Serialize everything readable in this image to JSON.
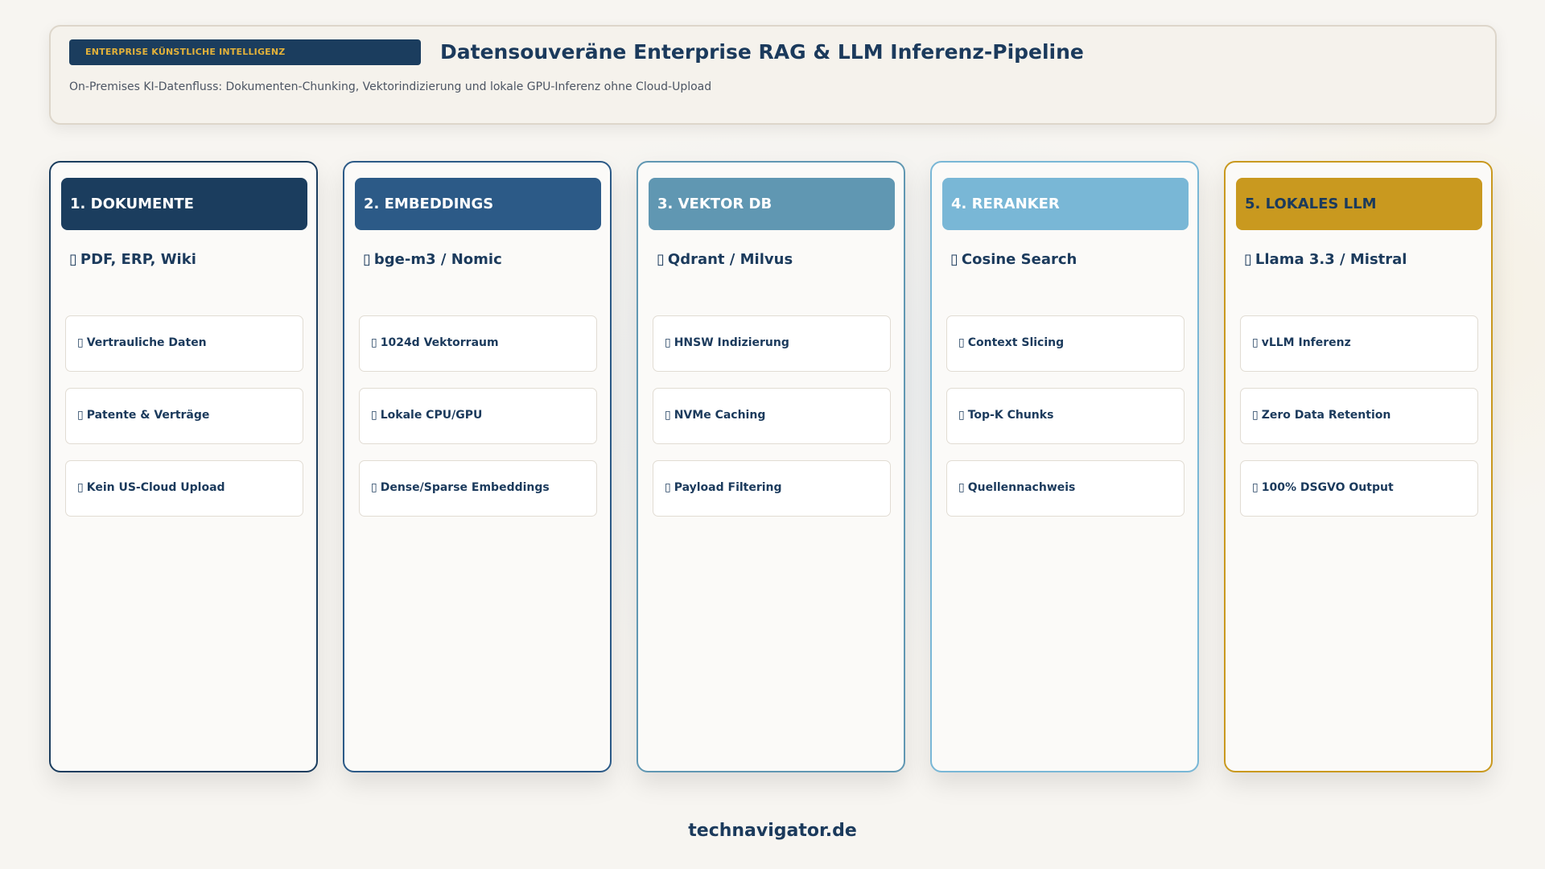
{
  "header": {
    "badge": "ENTERPRISE KÜNSTLICHE INTELLIGENZ",
    "title": "Datensouveräne Enterprise RAG & LLM Inferenz-Pipeline",
    "subtitle": "On-Premises KI-Datenfluss: Dokumenten-Chunking, Vektorindizierung und lokale GPU-Inferenz ohne Cloud-Upload"
  },
  "glyph": "▯",
  "columns": [
    {
      "title": "1. DOKUMENTE",
      "subtitle": "PDF, ERP, Wiki",
      "head_color": "#1b3d5e",
      "head_text": "#ffffff",
      "border_color": "#1b3d5e",
      "items": [
        "Vertrauliche Daten",
        "Patente & Verträge",
        "Kein US-Cloud Upload"
      ]
    },
    {
      "title": "2. EMBEDDINGS",
      "subtitle": "bge-m3 / Nomic",
      "head_color": "#2c5a87",
      "head_text": "#ffffff",
      "border_color": "#2c5a87",
      "items": [
        "1024d Vektorraum",
        "Lokale CPU/GPU",
        "Dense/Sparse Embeddings"
      ]
    },
    {
      "title": "3. VEKTOR DB",
      "subtitle": "Qdrant / Milvus",
      "head_color": "#6097b2",
      "head_text": "#ffffff",
      "border_color": "#6097b2",
      "items": [
        "HNSW Indizierung",
        "NVMe Caching",
        "Payload Filtering"
      ]
    },
    {
      "title": "4. RERANKER",
      "subtitle": "Cosine Search",
      "head_color": "#79b7d6",
      "head_text": "#ffffff",
      "border_color": "#79b7d6",
      "items": [
        "Context Slicing",
        "Top-K Chunks",
        "Quellennachweis"
      ]
    },
    {
      "title": "5. LOKALES LLM",
      "subtitle": "Llama 3.3 / Mistral",
      "head_color": "#c9991f",
      "head_text": "#1b3a5c",
      "border_color": "#c9991f",
      "items": [
        "vLLM Inferenz",
        "Zero Data Retention",
        "100% DSGVO Output"
      ]
    }
  ],
  "footer": "technavigator.de"
}
